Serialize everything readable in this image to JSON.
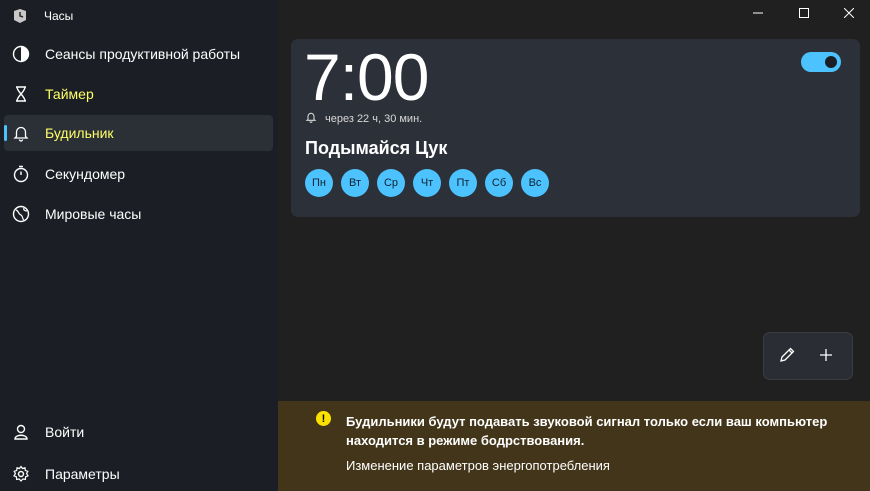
{
  "app": {
    "title": "Часы"
  },
  "sidebar": {
    "items": [
      {
        "label": "Сеансы продуктивной работы",
        "icon": "focus-icon"
      },
      {
        "label": "Таймер",
        "icon": "hourglass-icon"
      },
      {
        "label": "Будильник",
        "icon": "bell-icon"
      },
      {
        "label": "Секундомер",
        "icon": "stopwatch-icon"
      },
      {
        "label": "Мировые часы",
        "icon": "globe-icon"
      }
    ],
    "bottom": [
      {
        "label": "Войти",
        "icon": "person-icon"
      },
      {
        "label": "Параметры",
        "icon": "gear-icon"
      }
    ],
    "active_item": "Будильник"
  },
  "window_controls": [
    "minimize-icon",
    "maximize-icon",
    "close-icon"
  ],
  "alarm": {
    "time": "7:00",
    "remaining": "через 22 ч, 30 мин.",
    "name": "Подымайся Цук",
    "enabled": true,
    "days": [
      "Пн",
      "Вт",
      "Ср",
      "Чт",
      "Пт",
      "Сб",
      "Вс"
    ]
  },
  "actions": {
    "edit_icon": "pencil-icon",
    "add_icon": "plus-icon"
  },
  "banner": {
    "message": "Будильники будут подавать звуковой сигнал только если ваш компьютер находится в режиме бодрствования.",
    "link": "Изменение параметров энергопотребления",
    "icon_glyph": "!"
  },
  "colors": {
    "accent": "#4cc2ff",
    "sidebar_bg": "#1b1f25",
    "main_bg": "#202020",
    "card_bg": "#2c3038",
    "banner_bg": "#433519",
    "highlight_text": "#ffff66"
  }
}
